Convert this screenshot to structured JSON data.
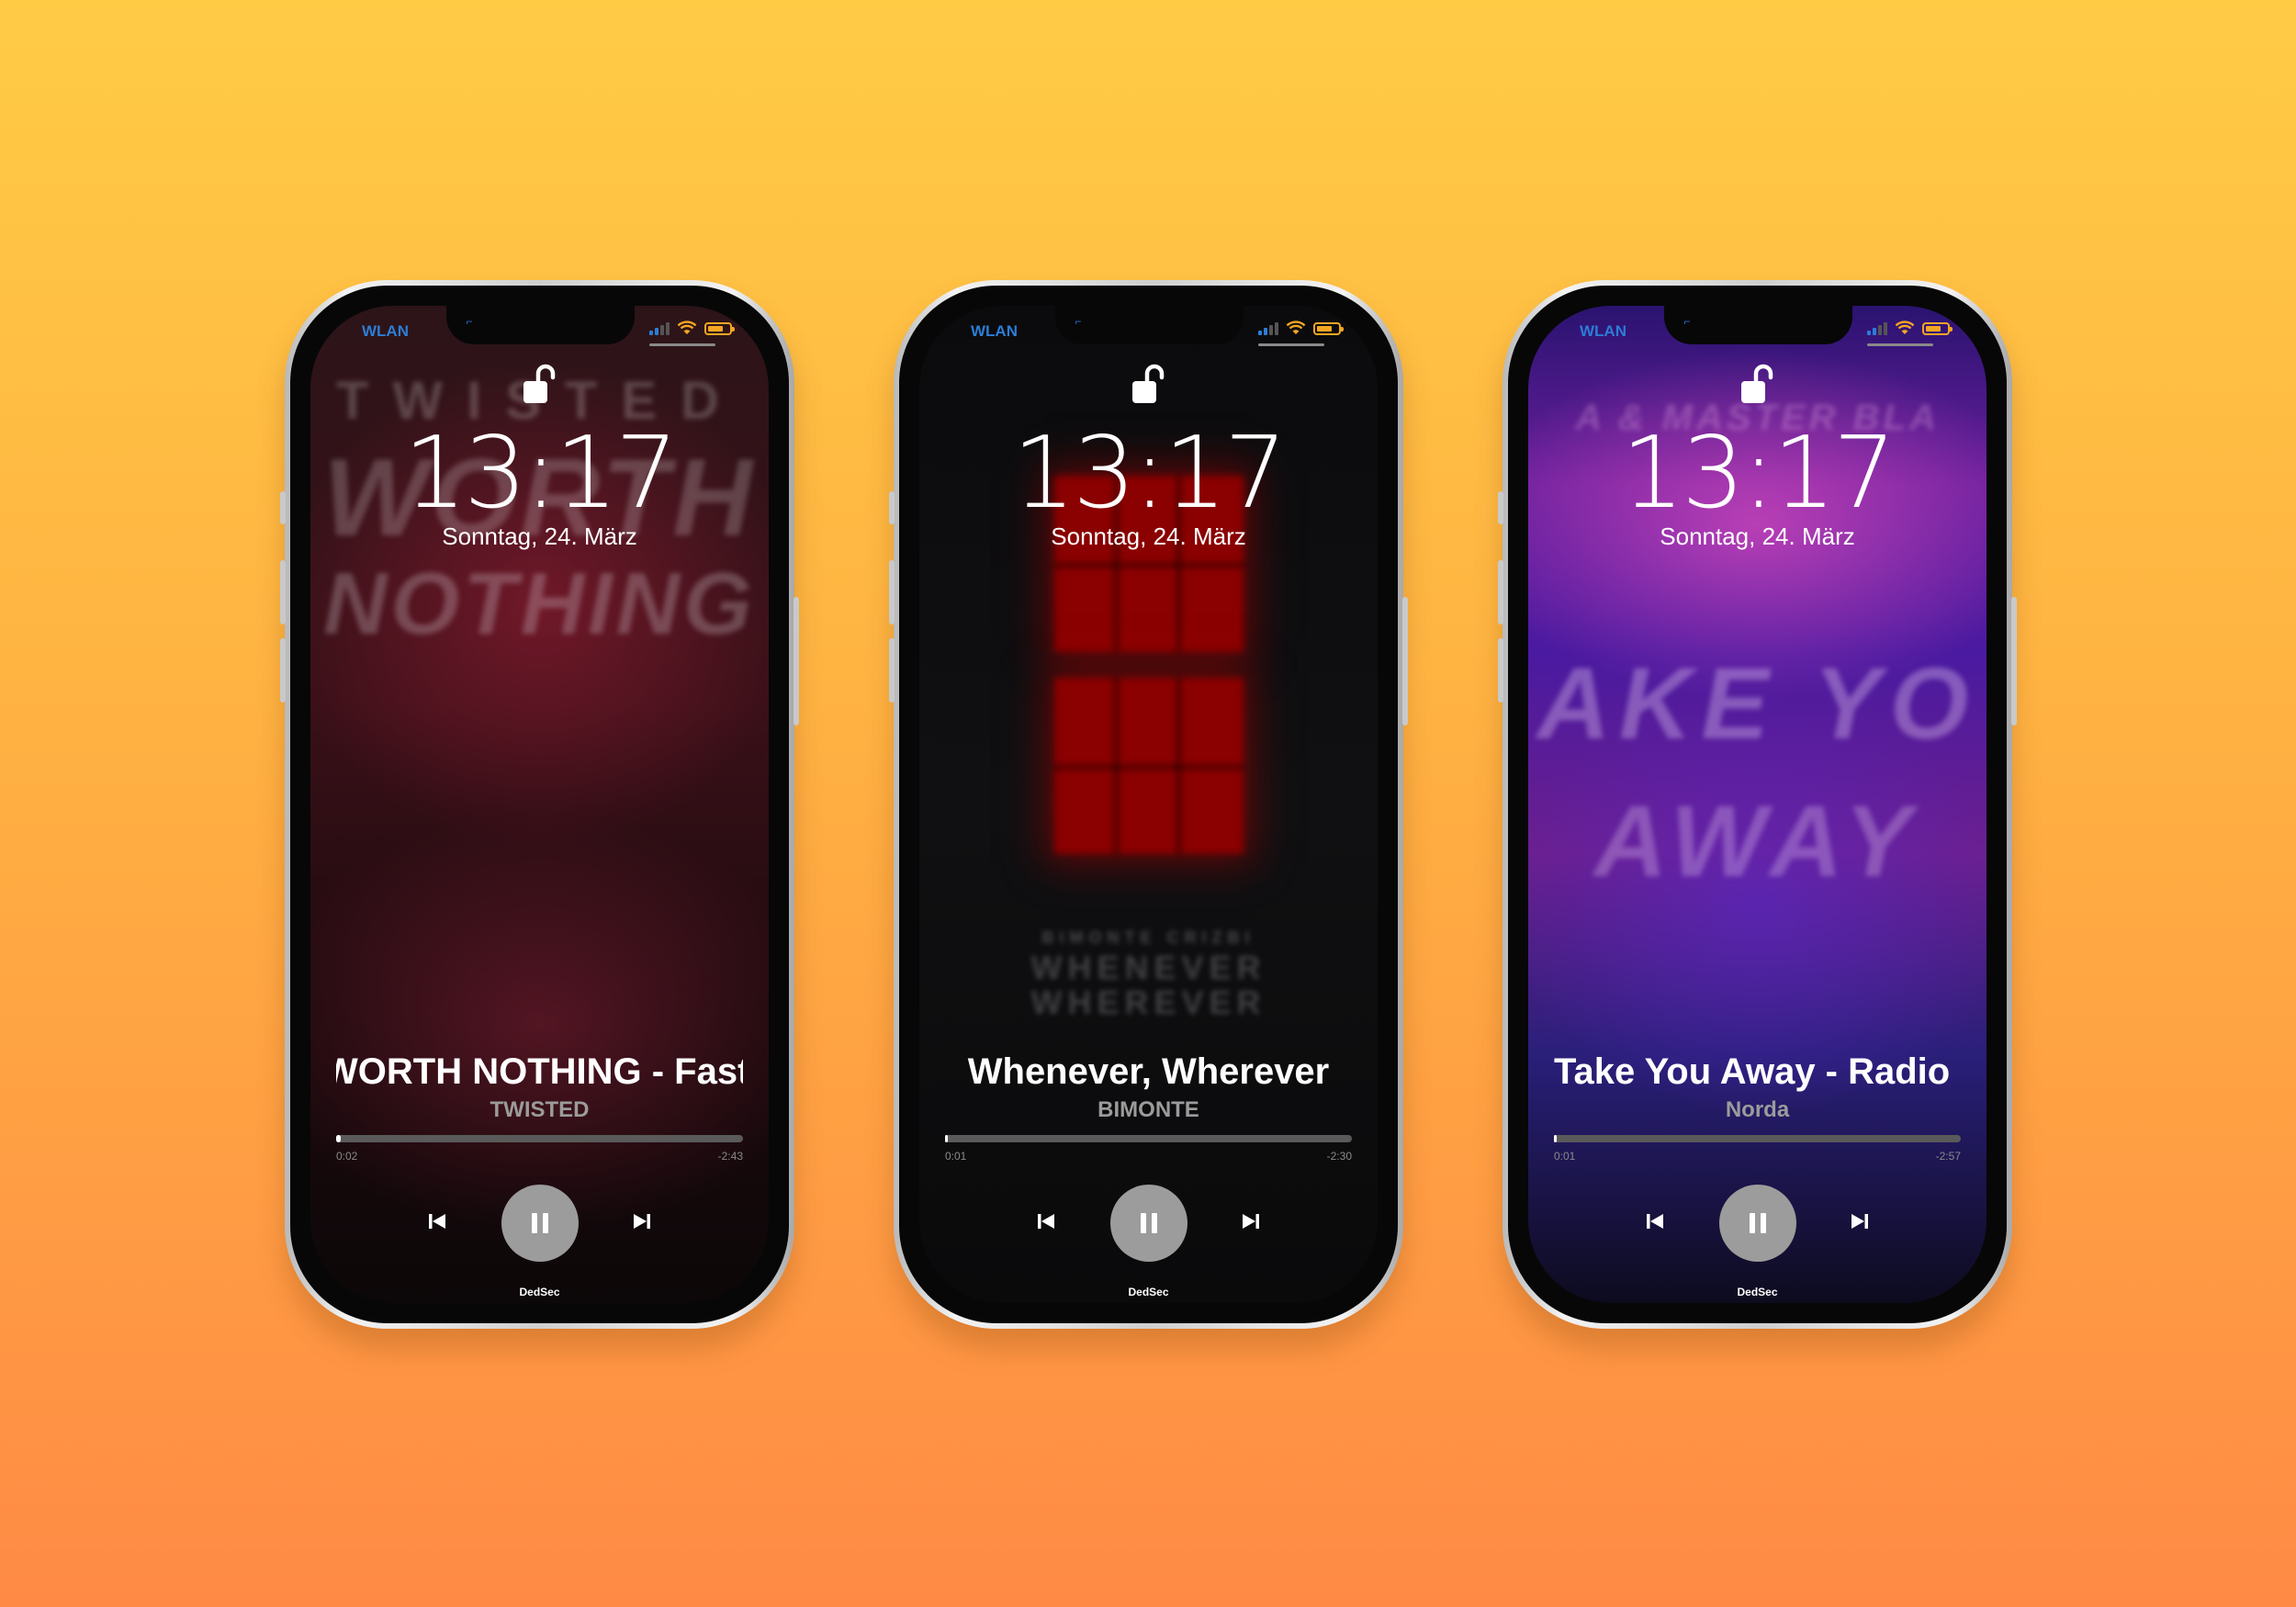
{
  "phones": [
    {
      "status_left": "WLAN",
      "clock": "13:17",
      "date": "Sonntag, 24. März",
      "track": "WORTH NOTHING - Fast",
      "artist": "TWISTED",
      "elapsed": "0:02",
      "remaining": "-2:43",
      "progress": 0.012,
      "device": "DedSec",
      "artwork_text": [
        "TWISTED",
        "WORTH",
        "NOTHING"
      ]
    },
    {
      "status_left": "WLAN",
      "clock": "13:17",
      "date": "Sonntag, 24. März",
      "track": "Whenever, Wherever",
      "artist": "BIMONTE",
      "elapsed": "0:01",
      "remaining": "-2:30",
      "progress": 0.007,
      "device": "DedSec",
      "artwork_text": [
        "BIMONTE CRIZBI",
        "WHENEVER",
        "WHEREVER"
      ]
    },
    {
      "status_left": "WLAN",
      "clock": "13:17",
      "date": "Sonntag, 24. März",
      "track": "Take You Away - Radio E",
      "artist": "Norda",
      "elapsed": "0:01",
      "remaining": "-2:57",
      "progress": 0.006,
      "device": "DedSec",
      "artwork_text": [
        "A & MASTER BLA",
        "AKE YO",
        "AWAY"
      ]
    }
  ],
  "colors": {
    "background_top": "#ffcb45",
    "background_bottom": "#ff8a45",
    "wlan_blue": "#2c7dd6",
    "status_orange": "#f5a623",
    "play_button": "#9c9c9c"
  },
  "icons": [
    "unlock-icon",
    "signal-icon",
    "wifi-icon",
    "battery-icon",
    "previous-track-icon",
    "pause-icon",
    "next-track-icon"
  ]
}
